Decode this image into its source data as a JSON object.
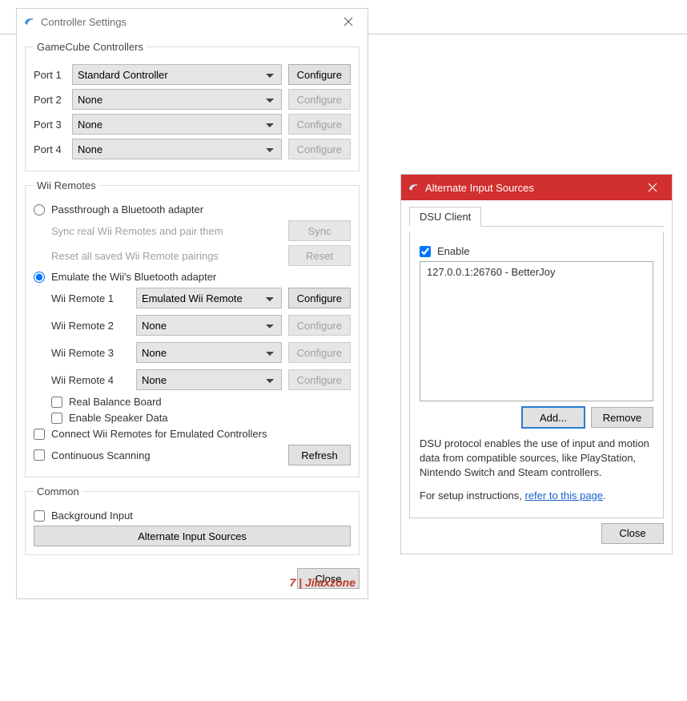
{
  "watermark": "7 | Jilaxzone",
  "window1": {
    "title": "Controller Settings",
    "gc": {
      "legend": "GameCube Controllers",
      "ports": [
        {
          "label": "Port 1",
          "value": "Standard Controller",
          "config": "Configure",
          "enabled": true
        },
        {
          "label": "Port 2",
          "value": "None",
          "config": "Configure",
          "enabled": false
        },
        {
          "label": "Port 3",
          "value": "None",
          "config": "Configure",
          "enabled": false
        },
        {
          "label": "Port 4",
          "value": "None",
          "config": "Configure",
          "enabled": false
        }
      ]
    },
    "wii": {
      "legend": "Wii Remotes",
      "passthrough_label": "Passthrough a Bluetooth adapter",
      "sync_text": "Sync real Wii Remotes and pair them",
      "sync_btn": "Sync",
      "reset_text": "Reset all saved Wii Remote pairings",
      "reset_btn": "Reset",
      "emulate_label": "Emulate the Wii's Bluetooth adapter",
      "remotes": [
        {
          "label": "Wii Remote 1",
          "value": "Emulated Wii Remote",
          "config": "Configure",
          "enabled": true
        },
        {
          "label": "Wii Remote 2",
          "value": "None",
          "config": "Configure",
          "enabled": false
        },
        {
          "label": "Wii Remote 3",
          "value": "None",
          "config": "Configure",
          "enabled": false
        },
        {
          "label": "Wii Remote 4",
          "value": "None",
          "config": "Configure",
          "enabled": false
        }
      ],
      "balance_board": "Real Balance Board",
      "speaker_data": "Enable Speaker Data",
      "connect_emulated": "Connect Wii Remotes for Emulated Controllers",
      "continuous_scan": "Continuous Scanning",
      "refresh_btn": "Refresh"
    },
    "common": {
      "legend": "Common",
      "background_input": "Background Input",
      "alt_sources_btn": "Alternate Input Sources"
    },
    "close_btn": "Close"
  },
  "window2": {
    "title": "Alternate Input Sources",
    "tab": "DSU Client",
    "enable_label": "Enable",
    "enable_checked": true,
    "list_item": "127.0.0.1:26760 - BetterJoy",
    "add_btn": "Add...",
    "remove_btn": "Remove",
    "desc1": "DSU protocol enables the use of input and motion data from compatible sources, like PlayStation, Nintendo Switch and Steam controllers.",
    "desc2_pre": "For setup instructions, ",
    "desc2_link": "refer to this page",
    "desc2_post": ".",
    "close_btn": "Close"
  }
}
